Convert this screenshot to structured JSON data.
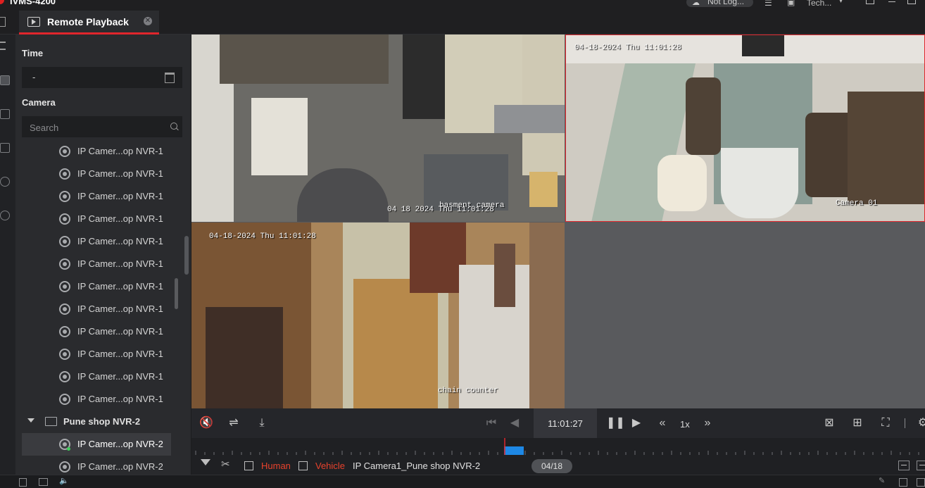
{
  "app": {
    "title": "iVMS-4200",
    "user": "Not Log...",
    "user_role": "Tech..."
  },
  "tab": {
    "label": "Remote Playback"
  },
  "side": {
    "time_label": "Time",
    "time_value": "-",
    "camera_label": "Camera",
    "search_placeholder": "Search",
    "camera_items": [
      "IP Camer...op NVR-1",
      "IP Camer...op NVR-1",
      "IP Camer...op NVR-1",
      "IP Camer...op NVR-1",
      "IP Camer...op NVR-1",
      "IP Camer...op NVR-1",
      "IP Camer...op NVR-1",
      "IP Camer...op NVR-1",
      "IP Camer...op NVR-1",
      "IP Camer...op NVR-1",
      "IP Camer...op NVR-1",
      "IP Camer...op NVR-1"
    ],
    "group_name": "Pune shop NVR-2",
    "group_items": [
      "IP Camer...op NVR-2",
      "IP Camer...op NVR-2"
    ]
  },
  "video": {
    "pane1_osd_time": "04 18 2024 Thu 11:01:28",
    "pane1_osd_name": "basment camera",
    "pane2_osd_time": "04-18-2024 Thu 11:01:28",
    "pane2_osd_name": "Camera 01",
    "pane3_osd_time": "04-18-2024 Thu 11:01:28",
    "pane3_osd_name": "chain counter"
  },
  "controls": {
    "current_time": "11:01:27",
    "speed": "1x"
  },
  "bottom": {
    "human_label": "Human",
    "vehicle_label": "Vehicle",
    "camera_name": "IP Camera1_Pune shop NVR-2",
    "date": "04/18"
  },
  "colors": {
    "accent": "#e0262c",
    "human": "#e8422c",
    "vehicle": "#e8422c",
    "timeline_marker": "#1e88e5"
  }
}
